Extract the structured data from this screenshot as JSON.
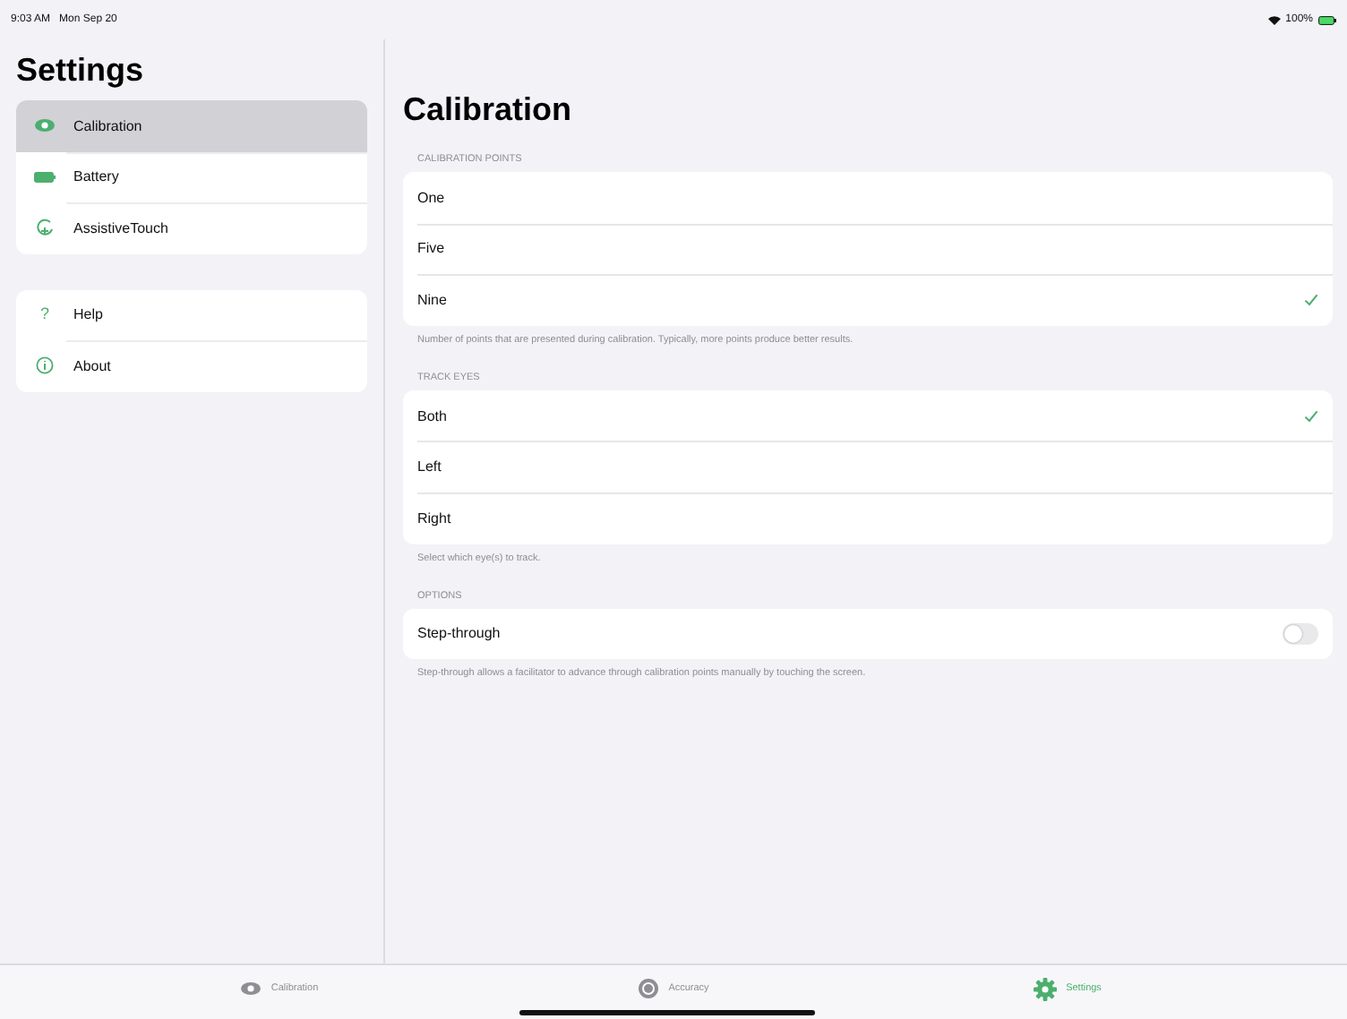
{
  "status_bar": {
    "time": "9:03 AM",
    "date": "Mon Sep 20",
    "battery": "100%"
  },
  "sidebar": {
    "title": "Settings",
    "groups": [
      [
        {
          "label": "Calibration",
          "kind": "eye",
          "selected": true
        },
        {
          "label": "Battery",
          "kind": "battery",
          "selected": false
        },
        {
          "label": "AssistiveTouch",
          "kind": "touch",
          "selected": false
        }
      ],
      [
        {
          "label": "Help",
          "kind": "help",
          "glyph": "?",
          "selected": false
        },
        {
          "label": "About",
          "kind": "info",
          "selected": false
        }
      ]
    ]
  },
  "main": {
    "title": "Calibration",
    "sections": [
      {
        "header": "CALIBRATION POINTS",
        "rows": [
          {
            "label": "One",
            "kind": "check",
            "checked": false
          },
          {
            "label": "Five",
            "kind": "check",
            "checked": false
          },
          {
            "label": "Nine",
            "kind": "check",
            "checked": true
          }
        ],
        "footer": "Number of points that are presented during calibration. Typically, more points produce better results."
      },
      {
        "header": "TRACK EYES",
        "rows": [
          {
            "label": "Both",
            "kind": "check",
            "checked": true
          },
          {
            "label": "Left",
            "kind": "check",
            "checked": false
          },
          {
            "label": "Right",
            "kind": "check",
            "checked": false
          }
        ],
        "footer": "Select which eye(s) to track."
      },
      {
        "header": "OPTIONS",
        "rows": [
          {
            "label": "Step-through",
            "kind": "toggle",
            "on": false
          }
        ],
        "footer": "Step-through allows a facilitator to advance through calibration points manually by touching the screen."
      }
    ]
  },
  "tab_bar": [
    {
      "label": "Calibration",
      "kind": "eye",
      "selected": false
    },
    {
      "label": "Accuracy",
      "kind": "target",
      "selected": false
    },
    {
      "label": "Settings",
      "kind": "gear",
      "selected": true
    }
  ]
}
